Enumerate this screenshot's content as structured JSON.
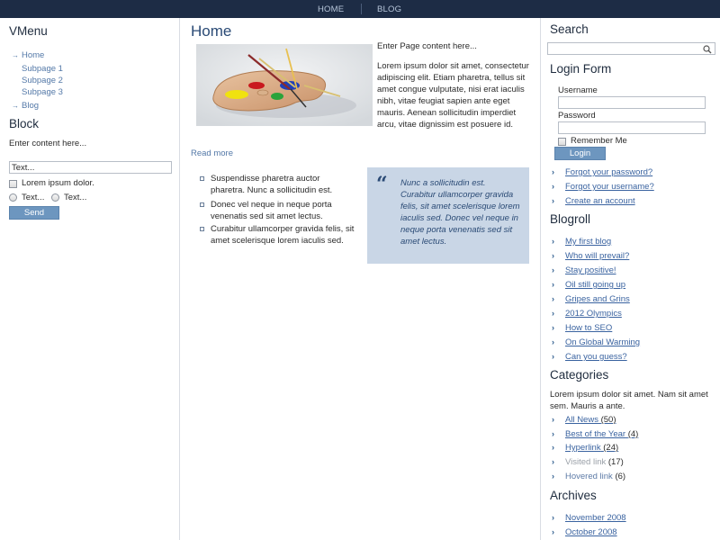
{
  "topnav": {
    "home": "HOME",
    "blog": "BLOG"
  },
  "vmenu": {
    "title": "VMenu",
    "items": [
      "Home",
      "Subpage 1",
      "Subpage 2",
      "Subpage 3",
      "Blog"
    ]
  },
  "block": {
    "title": "Block",
    "content": "Enter content here...",
    "text_input_value": "Text...",
    "checkbox_label": "Lorem ipsum dolor.",
    "radio1_label": "Text...",
    "radio2_label": "Text...",
    "send_label": "Send"
  },
  "main": {
    "title": "Home",
    "intro": "Enter Page content here...",
    "paragraph": "Lorem ipsum dolor sit amet, consectetur adipiscing elit. Etiam pharetra, tellus sit amet congue vulputate, nisi erat iaculis nibh, vitae feugiat sapien ante eget mauris. Aenean sollicitudin imperdiet arcu, vitae dignissim est posuere id.",
    "read_more": "Read more",
    "bullets": [
      "Suspendisse pharetra auctor pharetra. Nunc a sollicitudin est.",
      "Donec vel neque in neque porta venenatis sed sit amet lectus.",
      "Curabitur ullamcorper gravida felis, sit amet scelerisque lorem iaculis sed."
    ],
    "quote": "Nunc a sollicitudin est. Curabitur ullamcorper gravida felis, sit amet scelerisque lorem iaculis sed. Donec vel neque in neque porta venenatis sed sit amet lectus."
  },
  "search": {
    "title": "Search",
    "value": ""
  },
  "login": {
    "title": "Login Form",
    "username_label": "Username",
    "password_label": "Password",
    "remember_label": "Remember Me",
    "login_button": "Login",
    "links": [
      "Forgot your password?",
      "Forgot your username?",
      "Create an account"
    ]
  },
  "blogroll": {
    "title": "Blogroll",
    "items": [
      "My first blog",
      "Who will prevail?",
      "Stay positive!",
      "Oil still going up",
      "Gripes and Grins",
      "2012 Olympics",
      "How to SEO",
      "On Global Warming",
      "Can you guess?"
    ]
  },
  "categories": {
    "title": "Categories",
    "intro": "Lorem ipsum dolor sit amet. Nam sit amet sem. Mauris a ante.",
    "items": [
      {
        "label": "All News",
        "count": "(50)"
      },
      {
        "label": "Best of the Year",
        "count": "(4)"
      },
      {
        "label": "Hyperlink",
        "count": "(24)"
      },
      {
        "label": "Visited link",
        "count": "(17)"
      },
      {
        "label": "Hovered link",
        "count": "(6)"
      }
    ]
  },
  "archives": {
    "title": "Archives",
    "items": [
      "November 2008",
      "October 2008"
    ]
  },
  "colors": {
    "topnav_bg": "#1d2c45",
    "link": "#3a63a0",
    "accent_button": "#6d96bf",
    "quote_bg": "#c9d6e6",
    "visited": "#9aa0a8"
  }
}
